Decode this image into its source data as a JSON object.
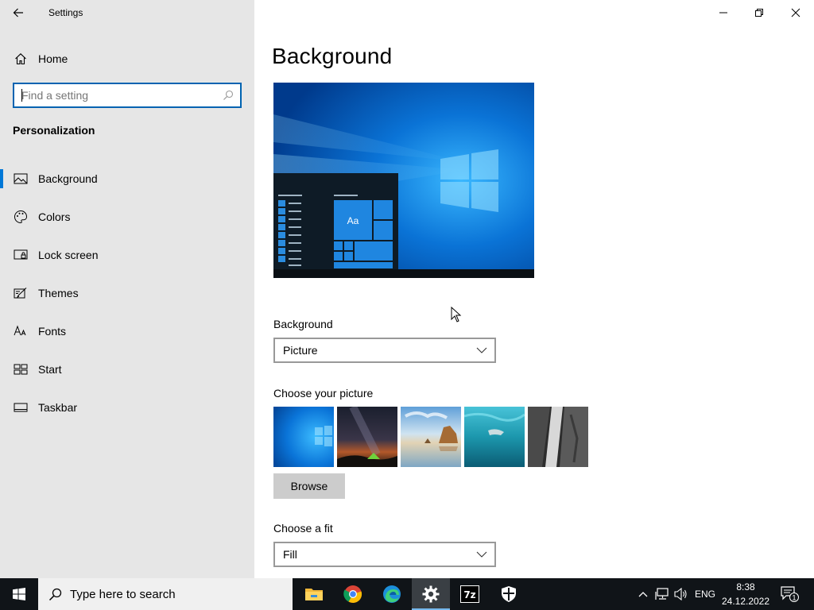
{
  "window": {
    "title": "Settings"
  },
  "sidebar": {
    "home_label": "Home",
    "search_placeholder": "Find a setting",
    "section_heading": "Personalization",
    "items": [
      {
        "label": "Background",
        "icon": "picture-icon",
        "active": true
      },
      {
        "label": "Colors",
        "icon": "palette-icon",
        "active": false
      },
      {
        "label": "Lock screen",
        "icon": "lock-screen-icon",
        "active": false
      },
      {
        "label": "Themes",
        "icon": "themes-icon",
        "active": false
      },
      {
        "label": "Fonts",
        "icon": "fonts-icon",
        "active": false
      },
      {
        "label": "Start",
        "icon": "start-icon",
        "active": false
      },
      {
        "label": "Taskbar",
        "icon": "taskbar-icon",
        "active": false
      }
    ]
  },
  "main": {
    "title": "Background",
    "preview": {
      "sample_text": "Aa"
    },
    "background_label": "Background",
    "background_value": "Picture",
    "choose_picture_label": "Choose your picture",
    "pictures": [
      "windows-blue",
      "night-sky-tent",
      "beach-rock",
      "underwater-swimmer",
      "rock-waterfall"
    ],
    "browse_label": "Browse",
    "fit_label": "Choose a fit",
    "fit_value": "Fill"
  },
  "taskbar": {
    "search_placeholder": "Type here to search",
    "apps": [
      "file-explorer",
      "chrome",
      "edge",
      "settings",
      "7-zip",
      "windows-security"
    ],
    "language": "ENG",
    "time": "8:38",
    "date": "24.12.2022",
    "notification_count": "1"
  },
  "colors": {
    "accent": "#0078d7",
    "sidebar_bg": "#e6e6e6",
    "taskbar_bg": "#101418"
  }
}
